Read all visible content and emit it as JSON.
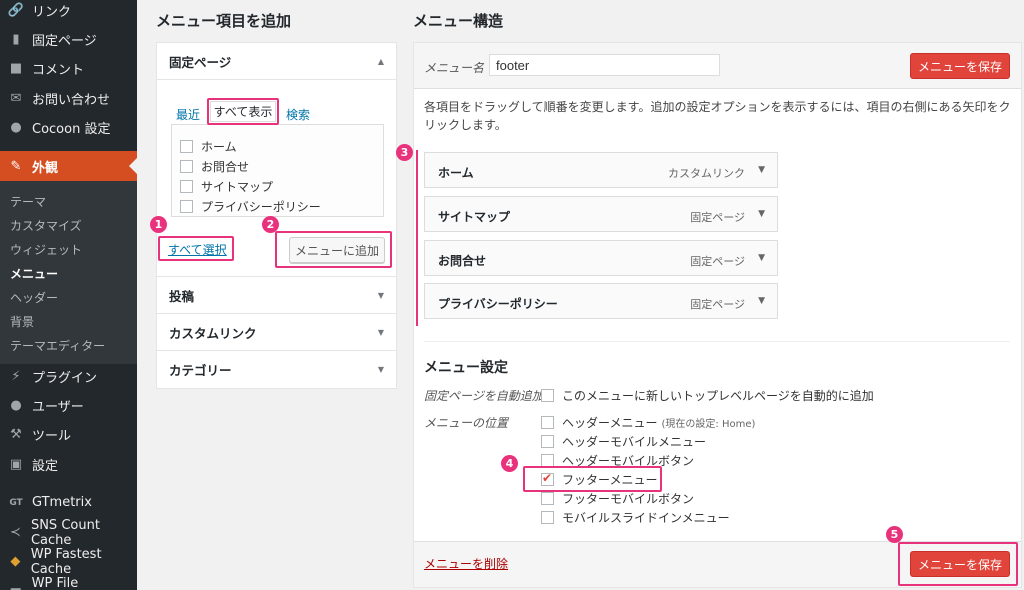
{
  "sidebar": {
    "items": [
      {
        "label": "リンク",
        "icon": "link-icon"
      },
      {
        "label": "固定ページ",
        "icon": "pages-icon"
      },
      {
        "label": "コメント",
        "icon": "comments-icon"
      },
      {
        "label": "お問い合わせ",
        "icon": "mail-icon"
      },
      {
        "label": "Cocoon 設定",
        "icon": "circle-icon"
      },
      {
        "label": "外観",
        "icon": "paintbrush-icon"
      },
      {
        "label": "プラグイン",
        "icon": "plugin-icon"
      },
      {
        "label": "ユーザー",
        "icon": "user-icon"
      },
      {
        "label": "ツール",
        "icon": "wrench-icon"
      },
      {
        "label": "設定",
        "icon": "settings-icon"
      },
      {
        "label": "GTmetrix",
        "icon": "gt-icon"
      },
      {
        "label": "SNS Count Cache",
        "icon": "share-icon"
      },
      {
        "label": "WP Fastest Cache",
        "icon": "cheetah-icon"
      },
      {
        "label": "WP File Manager",
        "icon": "folder-icon"
      }
    ],
    "submenu": [
      "テーマ",
      "カスタマイズ",
      "ウィジェット",
      "メニュー",
      "ヘッダー",
      "背景",
      "テーマエディター"
    ]
  },
  "left": {
    "heading": "メニュー項目を追加",
    "pages_section": "固定ページ",
    "tabs": {
      "recent": "最近",
      "all": "すべて表示",
      "search": "検索"
    },
    "pages": [
      "ホーム",
      "お問合せ",
      "サイトマップ",
      "プライバシーポリシー"
    ],
    "select_all": "すべて選択",
    "add_button": "メニューに追加",
    "sections": [
      "投稿",
      "カスタムリンク",
      "カテゴリー"
    ]
  },
  "right": {
    "heading": "メニュー構造",
    "name_label": "メニュー名",
    "name_value": "footer",
    "save_button": "メニューを保存",
    "description": "各項目をドラッグして順番を変更します。追加の設定オプションを表示するには、項目の右側にある矢印をクリックします。",
    "items": [
      {
        "title": "ホーム",
        "type": "カスタムリンク"
      },
      {
        "title": "サイトマップ",
        "type": "固定ページ"
      },
      {
        "title": "お問合せ",
        "type": "固定ページ"
      },
      {
        "title": "プライバシーポリシー",
        "type": "固定ページ"
      }
    ],
    "settings_heading": "メニュー設定",
    "auto_add_label": "固定ページを自動追加",
    "auto_add_option": "このメニューに新しいトップレベルページを自動的に追加",
    "location_label": "メニューの位置",
    "locations": [
      {
        "label": "ヘッダーメニュー",
        "note": "(現在の設定: Home)",
        "checked": false
      },
      {
        "label": "ヘッダーモバイルメニュー",
        "note": "",
        "checked": false
      },
      {
        "label": "ヘッダーモバイルボタン",
        "note": "",
        "checked": false
      },
      {
        "label": "フッターメニュー",
        "note": "",
        "checked": true
      },
      {
        "label": "フッターモバイルボタン",
        "note": "",
        "checked": false
      },
      {
        "label": "モバイルスライドインメニュー",
        "note": "",
        "checked": false
      }
    ],
    "delete_link": "メニューを削除"
  },
  "badges": [
    "1",
    "2",
    "3",
    "4",
    "5"
  ],
  "colors": {
    "accent": "#e9327c",
    "primary_button": "#e0443b",
    "sidebar_bg": "#23282d",
    "active_menu": "#d54e21"
  }
}
